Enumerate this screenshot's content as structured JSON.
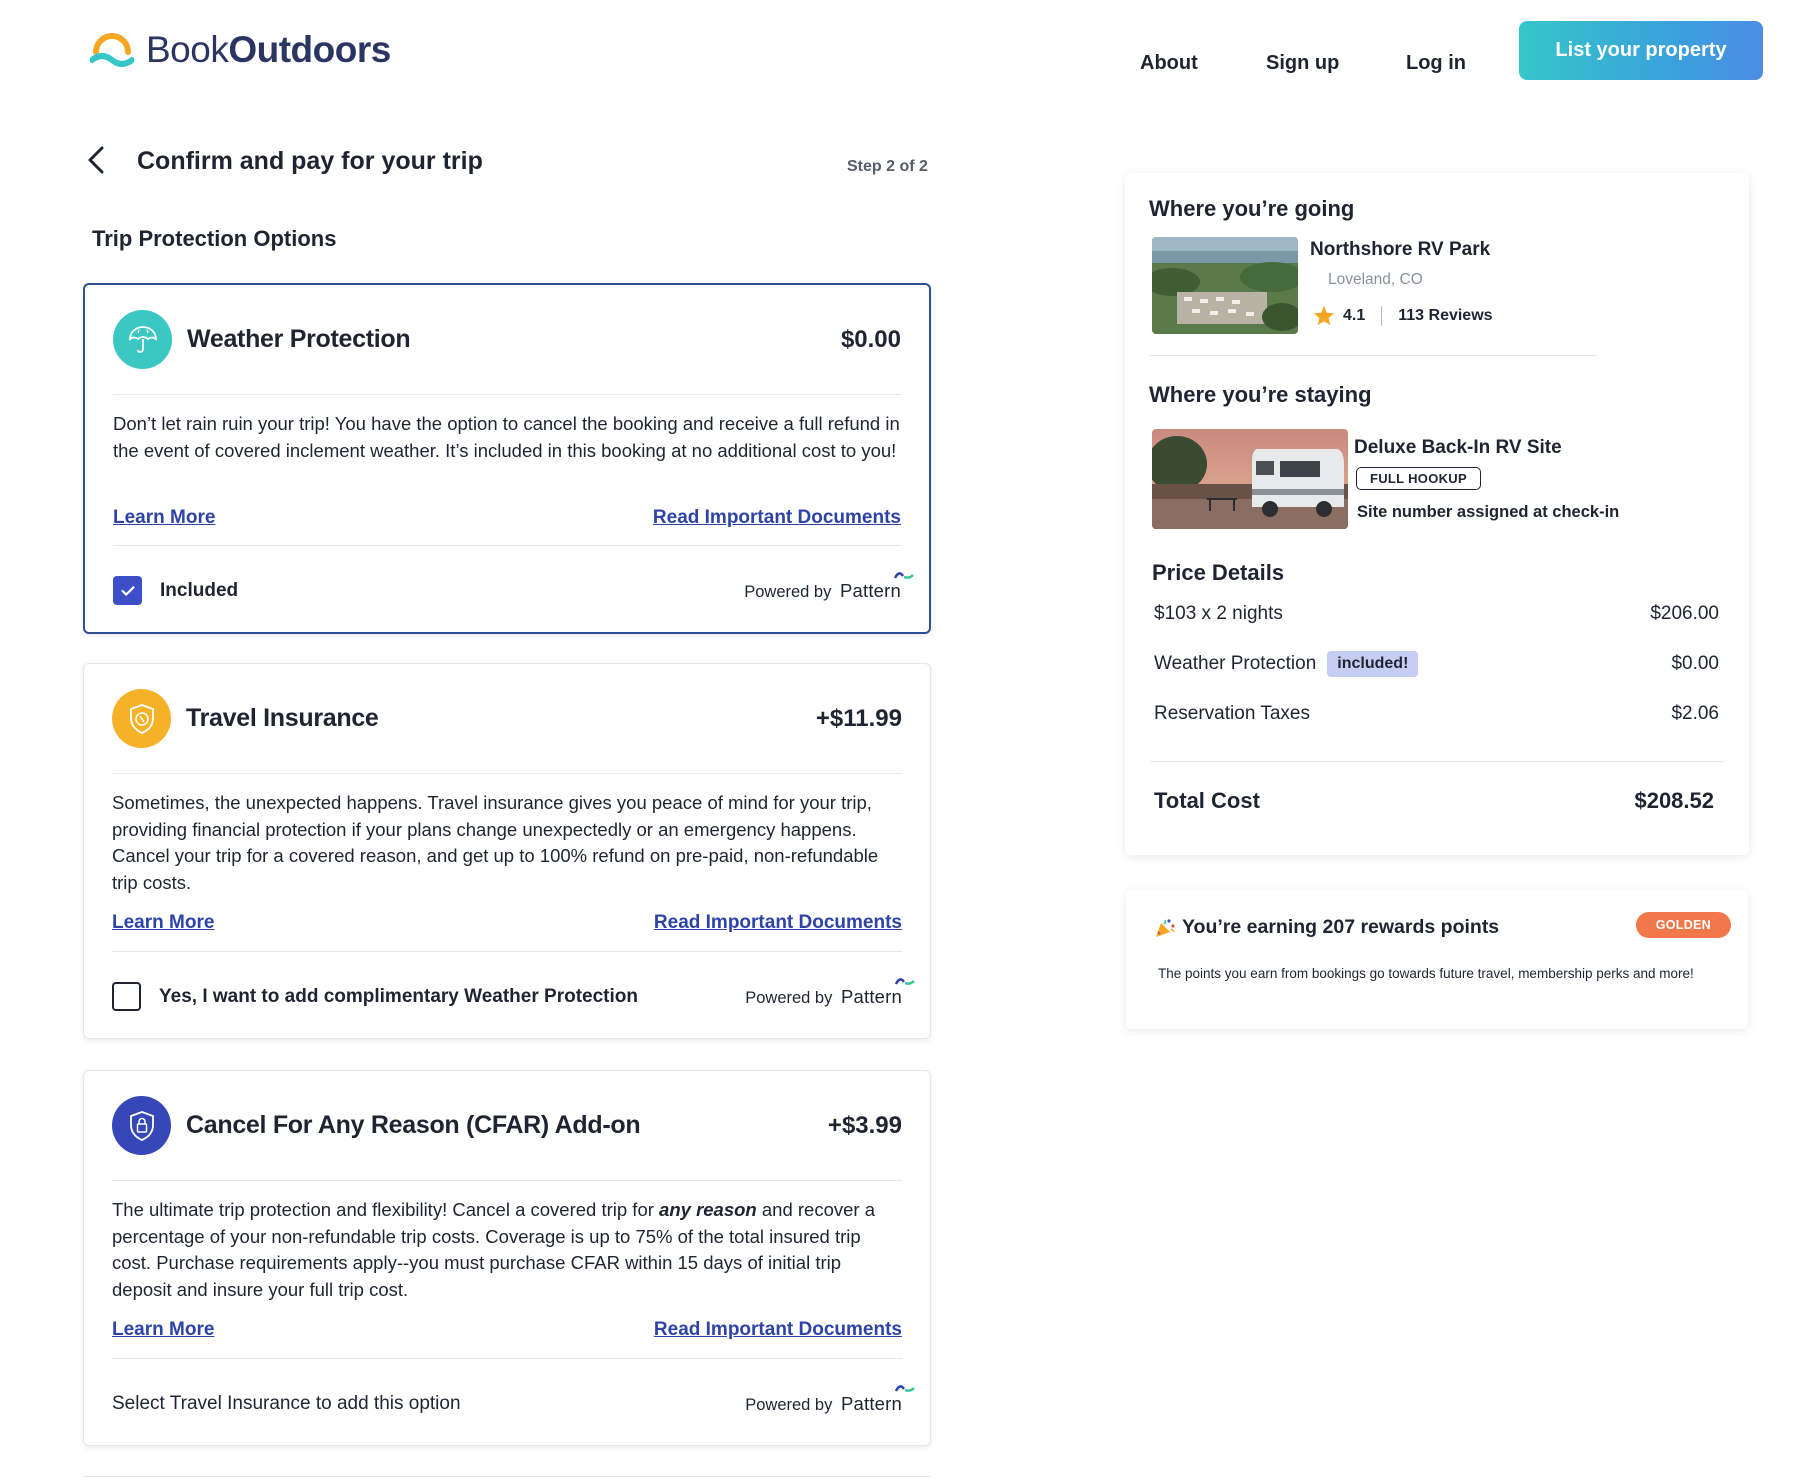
{
  "header": {
    "brand_light": "Book",
    "brand_bold": "Outdoors",
    "nav": [
      "About",
      "Sign up",
      "Log in"
    ],
    "cta_label": "List your property"
  },
  "page": {
    "title": "Confirm and pay for your trip",
    "step": "Step 2 of 2",
    "section_title": "Trip Protection Options"
  },
  "cards": [
    {
      "title": "Weather Protection",
      "price": "$0.00",
      "description": "Don’t let rain ruin your trip! You have the option to cancel the booking and receive a full refund in the event of covered inclement weather. It’s included in this booking at no additional cost to you!",
      "learn_more": "Learn More",
      "documents": "Read Important Documents",
      "footer_label": "Included",
      "checked": true,
      "powered_prefix": "Powered by",
      "powered_brand": "Pattern",
      "icon_color": "#3cc8c2"
    },
    {
      "title": "Travel Insurance",
      "price": "+$11.99",
      "description": "Sometimes, the unexpected happens. Travel insurance gives you peace of mind for your trip, providing financial protection if your plans change unexpectedly or an emergency happens. Cancel your trip for a covered reason, and get up to 100% refund on pre-paid, non-refundable trip costs.",
      "learn_more": "Learn More",
      "documents": "Read Important Documents",
      "footer_label": "Yes, I want to add complimentary Weather Protection",
      "checked": false,
      "powered_prefix": "Powered by",
      "powered_brand": "Pattern",
      "icon_color": "#f5b228"
    },
    {
      "title": "Cancel For Any Reason (CFAR) Add-on",
      "price": "+$3.99",
      "description_before": "The ultimate trip protection and flexibility! Cancel a covered trip for ",
      "description_emphasis": "any reason",
      "description_after": " and recover a percentage of your non-refundable trip costs. Coverage is up to 75% of the total insured trip cost. Purchase requirements apply--you must purchase CFAR within 15 days of initial trip deposit and insure your full trip cost.",
      "learn_more": "Learn More",
      "documents": "Read Important Documents",
      "footer_label": "Select Travel Insurance to add this option",
      "powered_prefix": "Powered by",
      "powered_brand": "Pattern",
      "icon_color": "#3647b8"
    }
  ],
  "summary": {
    "going_heading": "Where you’re going",
    "park_name": "Northshore RV Park",
    "park_location": "Loveland, CO",
    "rating": "4.1",
    "reviews": "113 Reviews",
    "staying_heading": "Where you’re staying",
    "site_name": "Deluxe Back-In RV Site",
    "site_badge": "FULL HOOKUP",
    "site_note": "Site number assigned at check-in",
    "price_heading": "Price Details",
    "rows": [
      {
        "label": "$103 x 2 nights",
        "amount": "$206.00"
      },
      {
        "label": "Weather Protection",
        "tag": "included!",
        "amount": "$0.00"
      },
      {
        "label": "Reservation Taxes",
        "amount": "$2.06"
      }
    ],
    "total_label": "Total Cost",
    "total_amount": "$208.52"
  },
  "rewards": {
    "title": "You’re earning 207 rewards points",
    "tier": "GOLDEN",
    "description": "The points you earn from bookings go towards future travel, membership perks and more!"
  },
  "colors": {
    "accent": "#3d4ec9",
    "link": "#2d43a8",
    "brand_navy": "#2a3562",
    "cta_start": "#35c6c9",
    "cta_end": "#4d8de3",
    "golden": "#f2784b"
  }
}
